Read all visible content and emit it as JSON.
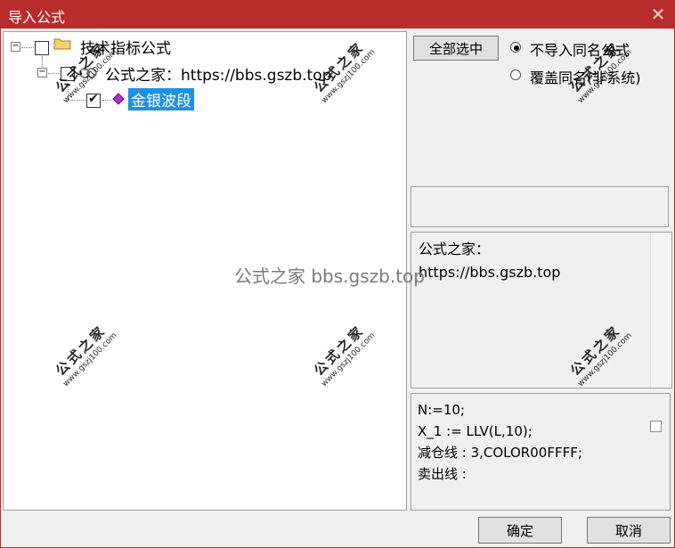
{
  "window": {
    "title": "导入公式",
    "close_glyph": "✕"
  },
  "tree": {
    "root": {
      "label": "技术指标公式",
      "expander": "−",
      "checked": false
    },
    "group": {
      "label": "公式之家：https://bbs.gszb.top",
      "expander": "−",
      "checked": false
    },
    "leaf": {
      "label": "金银波段",
      "checked": true
    }
  },
  "options": {
    "select_all_label": "全部选中",
    "radio_1_label": "不导入同名公式",
    "radio_2_label": "覆盖同名(非系统)",
    "selected": 1
  },
  "description": {
    "line1": "公式之家：",
    "line2": "https://bbs.gszb.top"
  },
  "code": {
    "lines": [
      "N:=10;",
      "X_1 := LLV(L,10);",
      "减仓线 : 3,COLOR00FFFF;",
      "卖出线 :"
    ]
  },
  "buttons": {
    "ok_label": "确定",
    "cancel_label": "取消"
  },
  "watermarks": {
    "cn": "公式之家",
    "url": "www.gszj100.com",
    "center": "公式之家 bbs.gszb.top"
  },
  "colors": {
    "title_bar": "#b82c2c",
    "selection": "#1e90e8",
    "leaf_icon": "#b12fd0"
  }
}
